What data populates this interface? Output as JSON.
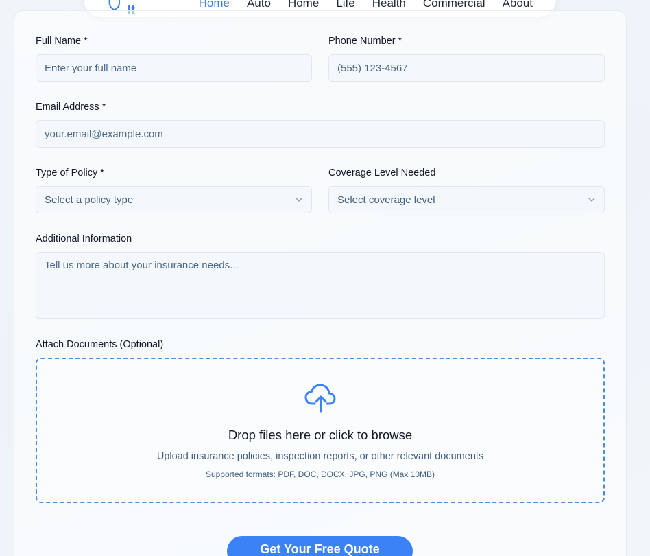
{
  "nav": {
    "brand": "Insure-It",
    "links": [
      "Home",
      "Auto",
      "Home",
      "Life",
      "Health",
      "Commercial",
      "About"
    ],
    "active_index": 0
  },
  "form": {
    "full_name": {
      "label": "Full Name *",
      "placeholder": "Enter your full name",
      "value": ""
    },
    "phone": {
      "label": "Phone Number *",
      "placeholder": "(555) 123-4567",
      "value": ""
    },
    "email": {
      "label": "Email Address *",
      "placeholder": "your.email@example.com",
      "value": ""
    },
    "policy_type": {
      "label": "Type of Policy *",
      "selected": "Select a policy type"
    },
    "coverage": {
      "label": "Coverage Level Needed",
      "selected": "Select coverage level"
    },
    "additional": {
      "label": "Additional Information",
      "placeholder": "Tell us more about your insurance needs...",
      "value": ""
    },
    "attach": {
      "label": "Attach Documents (Optional)",
      "title": "Drop files here or click to browse",
      "subtitle": "Upload insurance policies, inspection reports, or other relevant documents",
      "formats": "Supported formats: PDF, DOC, DOCX, JPG, PNG (Max 10MB)"
    },
    "submit_label": "Get Your Free Quote"
  },
  "colors": {
    "accent": "#3b82f6",
    "text": "#111827",
    "muted": "#3f5f82"
  },
  "icons": [
    "shield-icon",
    "chevron-down-icon",
    "cloud-upload-icon"
  ]
}
